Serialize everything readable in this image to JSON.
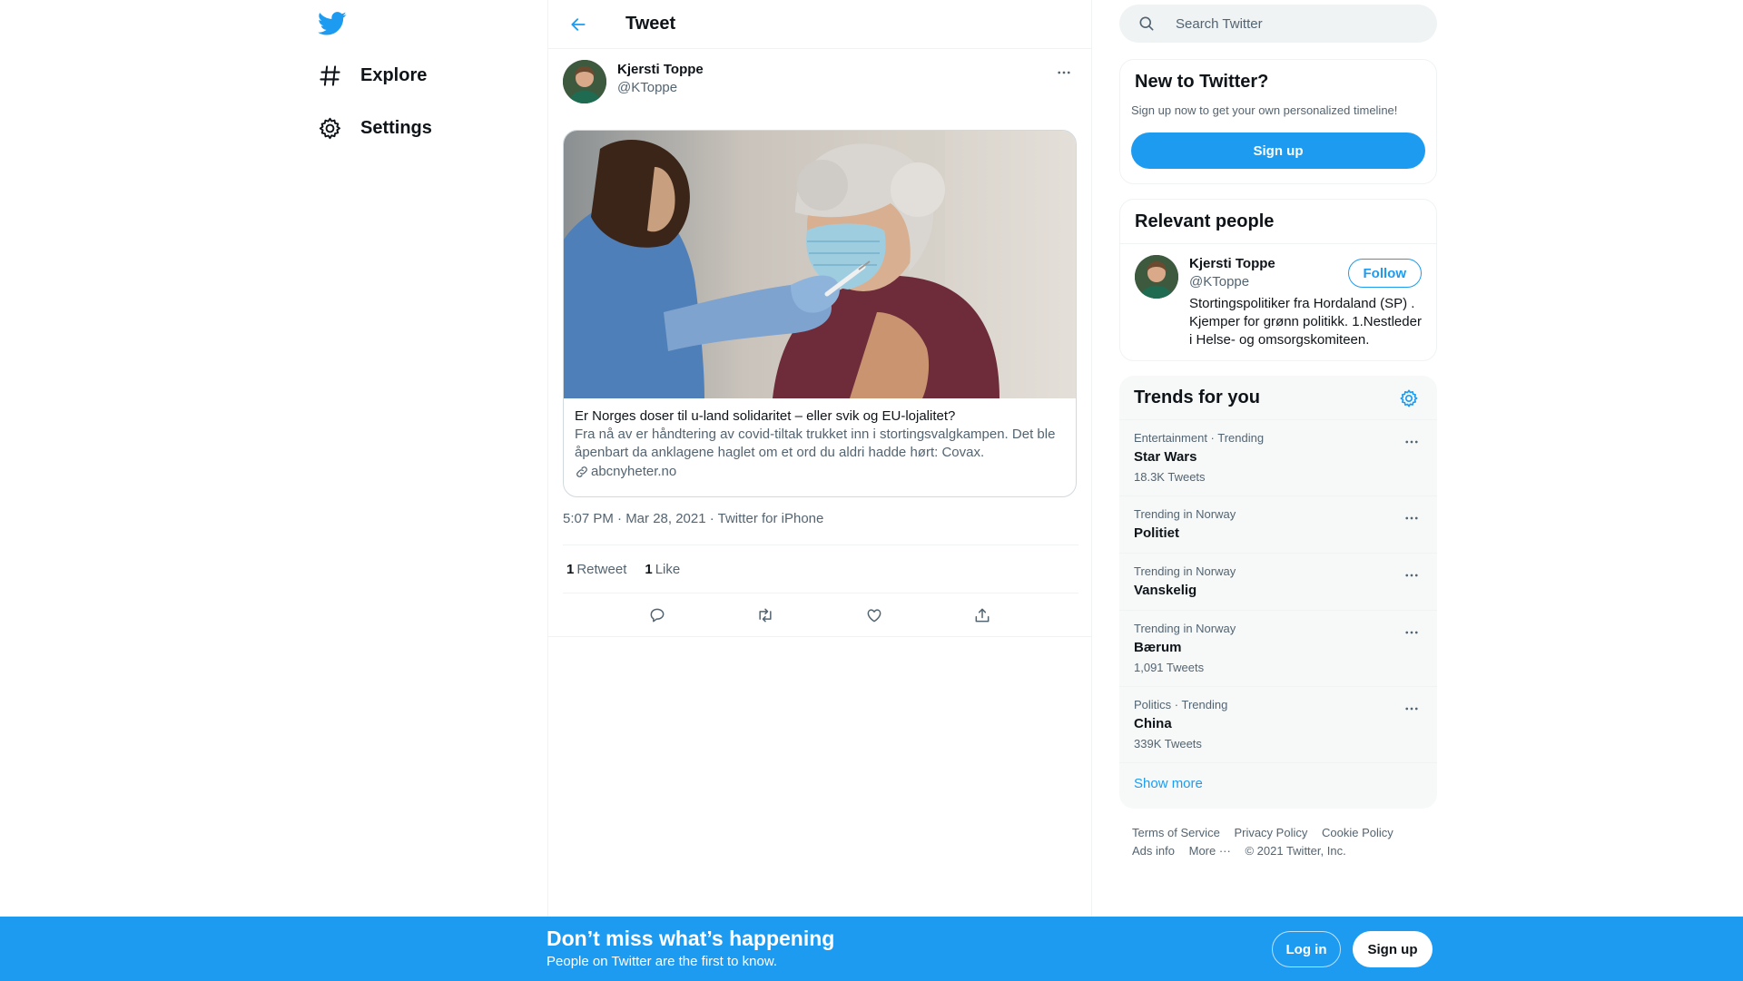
{
  "nav": {
    "logo_icon": "twitter-bird-icon",
    "items": [
      {
        "label": "Explore",
        "icon": "hashtag-icon"
      },
      {
        "label": "Settings",
        "icon": "gear-icon"
      }
    ]
  },
  "header": {
    "title": "Tweet",
    "back_icon": "arrow-left-icon"
  },
  "tweet": {
    "author_name": "Kjersti Toppe",
    "author_handle": "@KToppe",
    "card": {
      "title": "Er Norges doser til u-land solidaritet – eller svik og EU-lojalitet?",
      "description": "Fra nå av er håndtering av covid-tiltak trukket inn i stortingsvalgkampen. Det ble åpenbart da anklagene haglet om et ord du aldri hadde hørt: Covax.",
      "domain": "abcnyheter.no"
    },
    "meta": "5:07 PM · Mar 28, 2021 · Twitter for iPhone",
    "retweets_count": "1",
    "retweets_label": "Retweet",
    "likes_count": "1",
    "likes_label": "Like",
    "actions": [
      "reply-icon",
      "retweet-icon",
      "like-icon",
      "share-icon"
    ]
  },
  "search": {
    "placeholder": "Search Twitter"
  },
  "new_to_twitter": {
    "title": "New to Twitter?",
    "subtitle": "Sign up now to get your own personalized timeline!",
    "button": "Sign up"
  },
  "relevant_people": {
    "title": "Relevant people",
    "name": "Kjersti Toppe",
    "handle": "@KToppe",
    "bio": "Stortingspolitiker fra Hordaland (SP) . Kjemper for grønn politikk. 1.Nestleder i Helse- og omsorgskomiteen.",
    "follow": "Follow"
  },
  "trends": {
    "title": "Trends for you",
    "items": [
      {
        "meta": "Entertainment · Trending",
        "name": "Star Wars",
        "count": "18.3K Tweets"
      },
      {
        "meta": "Trending in Norway",
        "name": "Politiet",
        "count": ""
      },
      {
        "meta": "Trending in Norway",
        "name": "Vanskelig",
        "count": ""
      },
      {
        "meta": "Trending in Norway",
        "name": "Bærum",
        "count": "1,091 Tweets"
      },
      {
        "meta": "Politics · Trending",
        "name": "China",
        "count": "339K Tweets"
      }
    ],
    "show_more": "Show more"
  },
  "footer": {
    "terms": "Terms of Service",
    "privacy": "Privacy Policy",
    "cookie": "Cookie Policy",
    "ads": "Ads info",
    "more": "More ···",
    "copyright": "© 2021 Twitter, Inc."
  },
  "bottom_bar": {
    "title": "Don’t miss what’s happening",
    "subtitle": "People on Twitter are the first to know.",
    "login": "Log in",
    "signup": "Sign up"
  },
  "colors": {
    "accent": "#1d9bf0",
    "text": "#0f1419",
    "muted": "#536471"
  }
}
